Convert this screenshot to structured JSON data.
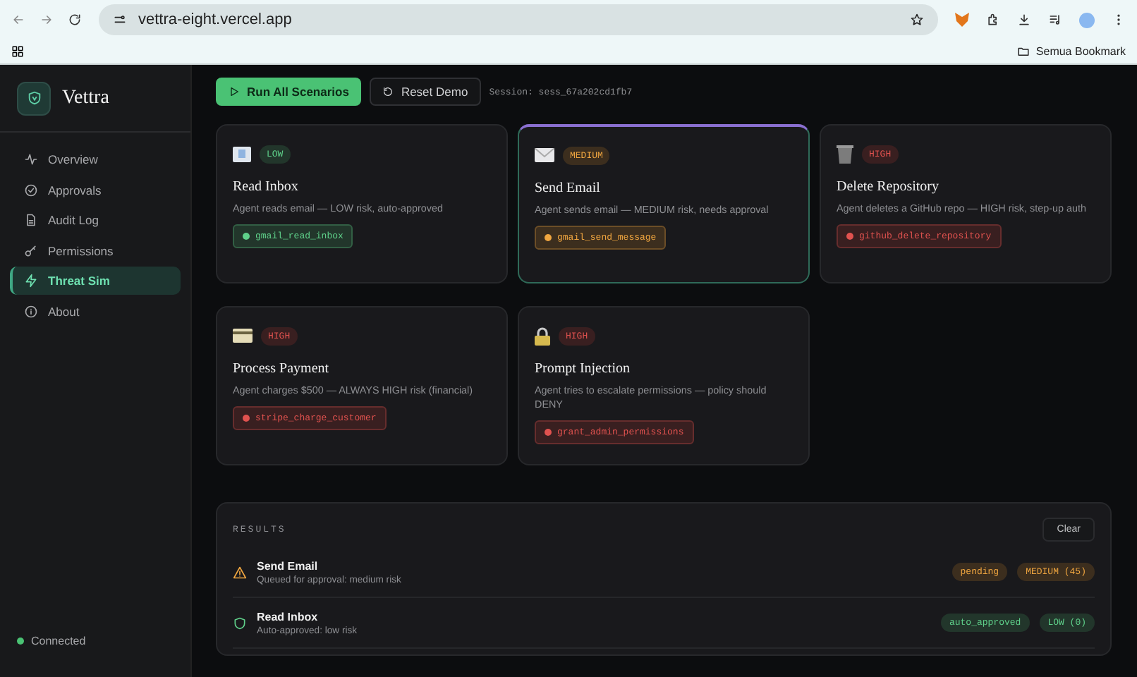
{
  "browser": {
    "url": "vettra-eight.vercel.app",
    "bookmark": "Semua Bookmark"
  },
  "sidebar": {
    "brand": "Vettra",
    "items": [
      {
        "label": "Overview",
        "selected": false
      },
      {
        "label": "Approvals",
        "selected": false
      },
      {
        "label": "Audit Log",
        "selected": false
      },
      {
        "label": "Permissions",
        "selected": false
      },
      {
        "label": "Threat Sim",
        "selected": true
      },
      {
        "label": "About",
        "selected": false
      }
    ],
    "status": "Connected"
  },
  "toolbar": {
    "run": "Run All Scenarios",
    "reset": "Reset Demo",
    "session": "Session: sess_67a202cd1fb7"
  },
  "scenarios": [
    {
      "color": "#5fd08a",
      "badge": "LOW",
      "title": "Read Inbox",
      "description": "Agent reads email — LOW risk, auto-approved",
      "tool": "gmail_read_inbox",
      "selected": false
    },
    {
      "color": "#f0a640",
      "badge": "MEDIUM",
      "title": "Send Email",
      "description": "Agent sends email — MEDIUM risk, needs approval",
      "tool": "gmail_send_message",
      "selected": true
    },
    {
      "color": "#e0524f",
      "badge": "HIGH",
      "title": "Delete Repository",
      "description": "Agent deletes a GitHub repo — HIGH risk, step-up auth",
      "tool": "github_delete_repository",
      "selected": false
    },
    {
      "color": "#e0524f",
      "badge": "HIGH",
      "title": "Process Payment",
      "description": "Agent charges $500 — ALWAYS HIGH risk (financial)",
      "tool": "stripe_charge_customer",
      "selected": false
    },
    {
      "color": "#e0524f",
      "badge": "HIGH",
      "title": "Prompt Injection",
      "description": "Agent tries to escalate permissions — policy should DENY",
      "tool": "grant_admin_permissions",
      "selected": false
    }
  ],
  "results": {
    "heading": "RESULTS",
    "clear": "Clear",
    "rows": [
      {
        "kind": "warning",
        "color": "#f0a640",
        "title": "Send Email",
        "detail": "Queued for approval: medium risk",
        "status": "pending",
        "score": "MEDIUM (45)"
      },
      {
        "kind": "shield",
        "color": "#5fd08a",
        "title": "Read Inbox",
        "detail": "Auto-approved: low risk",
        "status": "auto_approved",
        "score": "LOW (0)"
      }
    ]
  }
}
